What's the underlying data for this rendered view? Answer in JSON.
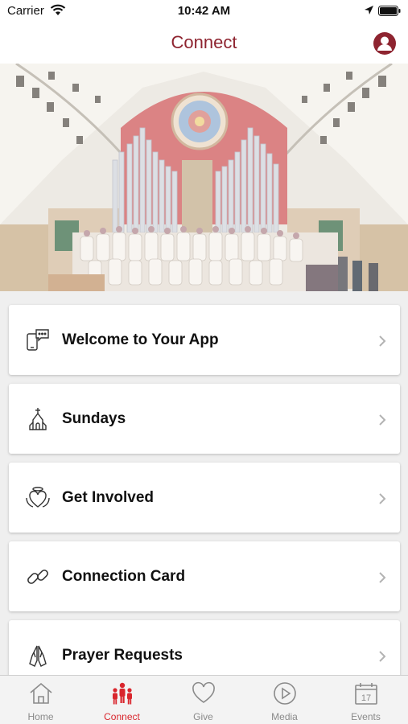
{
  "status_bar": {
    "carrier": "Carrier",
    "time": "10:42 AM",
    "wifi_icon": "wifi-icon",
    "location_icon": "location-arrow-icon",
    "battery_icon": "battery-icon"
  },
  "nav": {
    "title": "Connect",
    "profile_icon": "profile-icon"
  },
  "colors": {
    "brand": "#8e2430",
    "active_tab": "#d9262d",
    "inactive_tab": "#8a8a8a",
    "icon_gray": "#8a8a8a"
  },
  "menu": [
    {
      "label": "Welcome to Your App",
      "icon": "phone-chat-icon"
    },
    {
      "label": "Sundays",
      "icon": "church-icon"
    },
    {
      "label": "Get Involved",
      "icon": "heart-halo-icon"
    },
    {
      "label": "Connection Card",
      "icon": "link-icon"
    },
    {
      "label": "Prayer Requests",
      "icon": "praying-hands-icon"
    }
  ],
  "tabs": [
    {
      "label": "Home",
      "icon": "home-icon",
      "active": false
    },
    {
      "label": "Connect",
      "icon": "people-icon",
      "active": true
    },
    {
      "label": "Give",
      "icon": "heart-icon",
      "active": false
    },
    {
      "label": "Media",
      "icon": "play-circle-icon",
      "active": false
    },
    {
      "label": "Events",
      "icon": "calendar-icon",
      "active": false
    }
  ],
  "calendar_day": "17"
}
